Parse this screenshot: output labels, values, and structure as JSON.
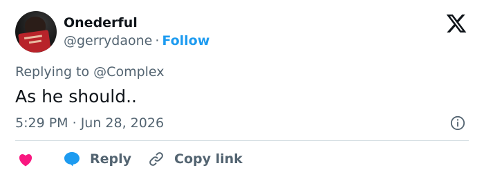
{
  "tweet": {
    "author": {
      "display_name": "Onederful",
      "handle": "@gerrydaone",
      "separator": "·",
      "follow_label": "Follow"
    },
    "replying_prefix": "Replying to",
    "replying_to": "@Complex",
    "text": "As he should..",
    "time": "5:29 PM",
    "date_separator": "·",
    "date": "Jun 28, 2026"
  },
  "actions": {
    "reply_label": "Reply",
    "copy_link_label": "Copy link"
  },
  "icons": {
    "brand": "x-logo-icon",
    "info": "info-icon",
    "like": "heart-icon",
    "reply": "reply-bubble-icon",
    "copy": "link-icon"
  },
  "colors": {
    "accent": "#1d9bf0",
    "like": "#f91880",
    "muted_text": "#536471",
    "primary_text": "#0f1419",
    "divider": "#cfd9de"
  }
}
